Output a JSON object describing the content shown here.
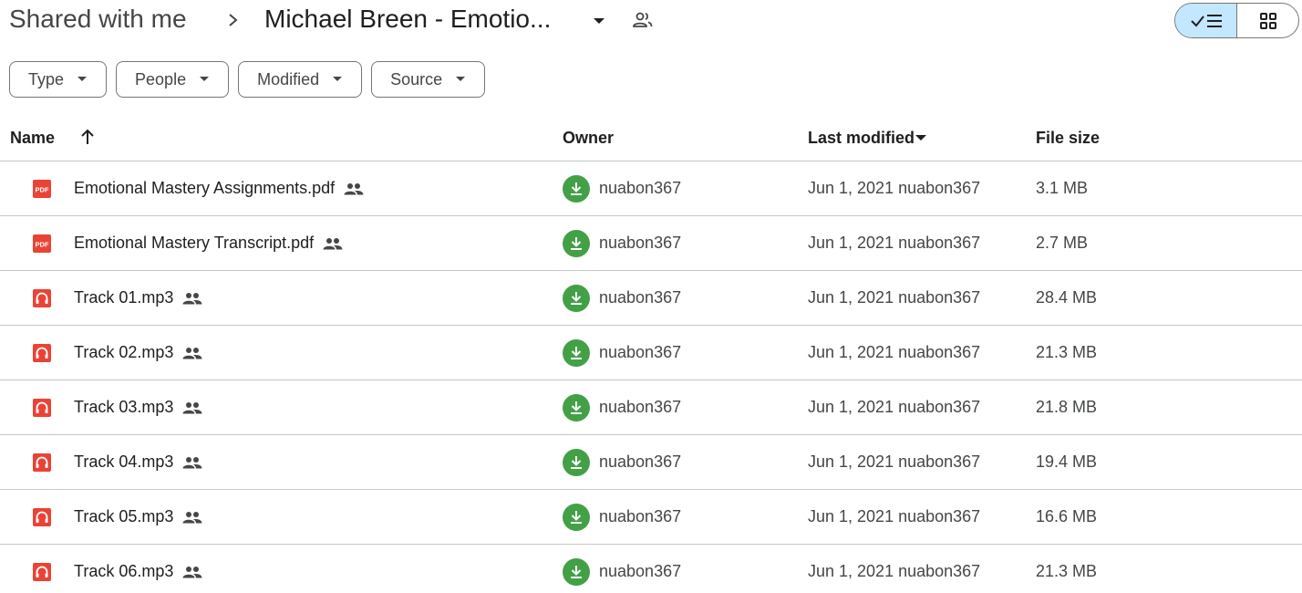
{
  "breadcrumb": {
    "root": "Shared with me",
    "current": "Michael Breen - Emotio..."
  },
  "filters": [
    {
      "label": "Type"
    },
    {
      "label": "People"
    },
    {
      "label": "Modified"
    },
    {
      "label": "Source"
    }
  ],
  "table": {
    "headers": {
      "name": "Name",
      "owner": "Owner",
      "modified": "Last modified",
      "size": "File size"
    },
    "rows": [
      {
        "type": "pdf",
        "name": "Emotional Mastery Assignments.pdf",
        "owner": "nuabon367",
        "modified": "Jun 1, 2021 nuabon367",
        "size": "3.1 MB"
      },
      {
        "type": "pdf",
        "name": "Emotional Mastery Transcript.pdf",
        "owner": "nuabon367",
        "modified": "Jun 1, 2021 nuabon367",
        "size": "2.7 MB"
      },
      {
        "type": "audio",
        "name": "Track 01.mp3",
        "owner": "nuabon367",
        "modified": "Jun 1, 2021 nuabon367",
        "size": "28.4 MB"
      },
      {
        "type": "audio",
        "name": "Track 02.mp3",
        "owner": "nuabon367",
        "modified": "Jun 1, 2021 nuabon367",
        "size": "21.3 MB"
      },
      {
        "type": "audio",
        "name": "Track 03.mp3",
        "owner": "nuabon367",
        "modified": "Jun 1, 2021 nuabon367",
        "size": "21.8 MB"
      },
      {
        "type": "audio",
        "name": "Track 04.mp3",
        "owner": "nuabon367",
        "modified": "Jun 1, 2021 nuabon367",
        "size": "19.4 MB"
      },
      {
        "type": "audio",
        "name": "Track 05.mp3",
        "owner": "nuabon367",
        "modified": "Jun 1, 2021 nuabon367",
        "size": "16.6 MB"
      },
      {
        "type": "audio",
        "name": "Track 06.mp3",
        "owner": "nuabon367",
        "modified": "Jun 1, 2021 nuabon367",
        "size": "21.3 MB"
      }
    ]
  },
  "icons": {
    "pdf_label": "PDF",
    "pdf_color": "#ea4335",
    "audio_color": "#ea4335",
    "owner_avatar_color": "#43a047",
    "list_view_active_color": "#c2e7ff"
  }
}
